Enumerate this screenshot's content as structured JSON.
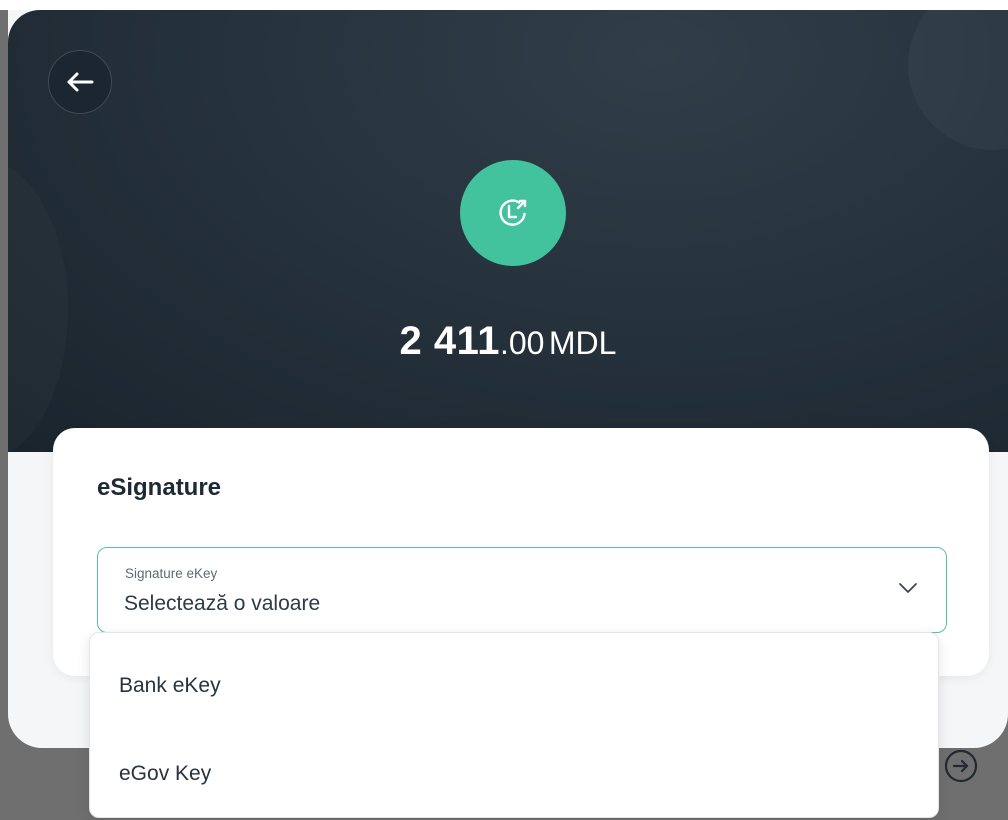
{
  "header": {
    "amount_integer": "2 411",
    "amount_decimal": ".00",
    "currency": "MDL"
  },
  "icons": {
    "back": "arrow-left-icon",
    "status": "clock-arrow-icon",
    "chevron": "chevron-down-icon",
    "next": "arrow-right-circle-icon"
  },
  "colors": {
    "accent": "#42c29d",
    "select_border": "#5bbfa8",
    "hero_background": "#26323c"
  },
  "esignature": {
    "title": "eSignature",
    "select": {
      "label": "Signature eKey",
      "placeholder": "Selectează o valoare"
    },
    "options": [
      {
        "label": "Bank eKey"
      },
      {
        "label": "eGov Key"
      }
    ]
  }
}
